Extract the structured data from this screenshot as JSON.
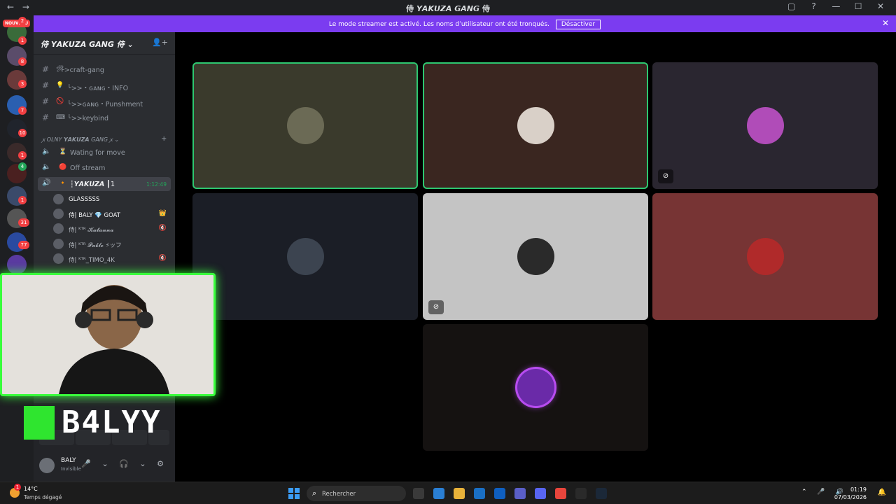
{
  "window": {
    "title": "侍 𝙔𝘼𝙆𝙐𝙕𝘼 𝙂𝘼𝙉𝙂 侍",
    "back": "←",
    "forward": "→",
    "controls": [
      "▢",
      "?",
      "—",
      "☐",
      "✕"
    ]
  },
  "banner": {
    "message": "Le mode streamer est activé. Les noms d’utilisateur ont été tronqués.",
    "button": "Désactiver",
    "close": "✕"
  },
  "rail": {
    "new_label": "NOUVEAU",
    "badges": [
      "2",
      "1",
      "8",
      "3",
      "7",
      "10",
      "1",
      "4",
      "1",
      "31",
      "77"
    ]
  },
  "server": {
    "name": "侍 𝙔𝘼𝙆𝙐𝙕𝘼 𝙂𝘼𝙉𝙂 侍 ⌄",
    "channels": [
      {
        "icon": "🛠",
        "label": "╰>craft-gang"
      },
      {
        "icon": "💡",
        "label": "╰>>・ɢᴀɴɢ・INFO"
      },
      {
        "icon": "🚫",
        "label": "╰>>ɢᴀɴɢ・Punshment"
      },
      {
        "icon": "⌨",
        "label": "╰>>keybind"
      }
    ],
    "category": "ꭗ OLNY 𝙔𝘼𝙆𝙐𝙕𝘼 GANG ꭗ ⌄",
    "voice_channels": [
      {
        "icon": "⏳",
        "label": "Wating for move"
      },
      {
        "icon": "🔴",
        "label": "Off stream"
      },
      {
        "icon": "🔸",
        "label": "┆𝙔𝘼𝙆𝙐𝙕𝘼 ┃1",
        "time": "1:12:49"
      }
    ],
    "members": [
      {
        "name": "GLASSSSS",
        "extra": ""
      },
      {
        "name": "侍| BALY 💎 GOAT",
        "extra": "👑"
      },
      {
        "name": "侍| ᴷᵀᴿ 𝓚𝓪𝓽𝓪𝓷𝓷𝓪",
        "extra": "🔇"
      },
      {
        "name": "侍| ᴷᵀᴿ 𝓟𝓪𝓫𝓵𝓸 ⚡ッフ",
        "extra": ""
      },
      {
        "name": "侍| ᴷᵀᴿ_TIMO_4K",
        "extra": "🔇"
      }
    ]
  },
  "user": {
    "name": "BALY",
    "status": "Invisible",
    "controls": "🎤 ⌄ 🎧 ⌄ ⚙"
  },
  "overlay": {
    "logo_text": "B4LYY"
  },
  "tiles": [
    {
      "bg": "#3a3a2c",
      "speaking": true,
      "avatar": "#6b6a55",
      "flag": ""
    },
    {
      "bg": "#3a2620",
      "speaking": true,
      "avatar": "#d9d0c8",
      "flag": ""
    },
    {
      "bg": "#2a2630",
      "speaking": false,
      "avatar": "#b04cb8",
      "flag": "⊘"
    },
    {
      "bg": "#1b1e26",
      "speaking": false,
      "avatar": "#3c4450",
      "flag": ""
    },
    {
      "bg": "#c4c4c4",
      "speaking": false,
      "avatar": "#2a2a2a",
      "flag": "⊘"
    },
    {
      "bg": "#773434",
      "speaking": false,
      "avatar": "#b02a2a",
      "flag": ""
    },
    {
      "bg": "#151211",
      "speaking": false,
      "avatar": "#6a2aa8",
      "flag": ""
    }
  ],
  "taskbar": {
    "weather_temp": "14°C",
    "weather_desc": "Temps dégagé",
    "weather_badge": "1",
    "search_placeholder": "Rechercher",
    "time": "01:19",
    "date": "07/03/2026",
    "apps": [
      "#3a3a3a",
      "#2a7fd4",
      "#e8b23a",
      "#1a6fc4",
      "#0f5fc0",
      "#5a5fc8",
      "#5865f2",
      "#e8453c",
      "#2a2a2a",
      "#1b2838"
    ]
  }
}
